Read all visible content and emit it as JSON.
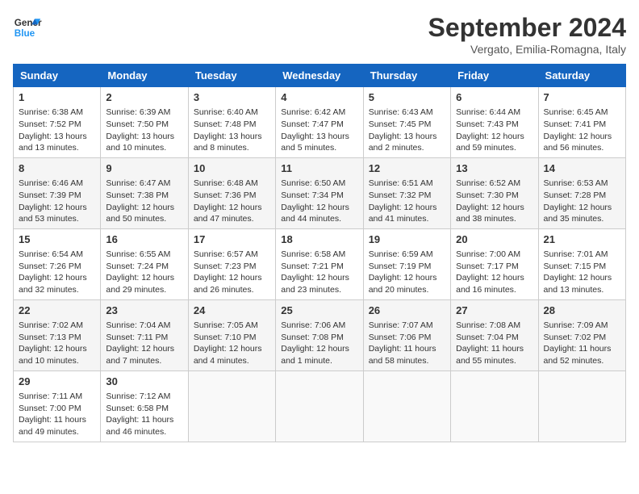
{
  "logo": {
    "line1": "General",
    "line2": "Blue"
  },
  "title": "September 2024",
  "subtitle": "Vergato, Emilia-Romagna, Italy",
  "days_of_week": [
    "Sunday",
    "Monday",
    "Tuesday",
    "Wednesday",
    "Thursday",
    "Friday",
    "Saturday"
  ],
  "weeks": [
    [
      {
        "day": "1",
        "lines": [
          "Sunrise: 6:38 AM",
          "Sunset: 7:52 PM",
          "Daylight: 13 hours",
          "and 13 minutes."
        ]
      },
      {
        "day": "2",
        "lines": [
          "Sunrise: 6:39 AM",
          "Sunset: 7:50 PM",
          "Daylight: 13 hours",
          "and 10 minutes."
        ]
      },
      {
        "day": "3",
        "lines": [
          "Sunrise: 6:40 AM",
          "Sunset: 7:48 PM",
          "Daylight: 13 hours",
          "and 8 minutes."
        ]
      },
      {
        "day": "4",
        "lines": [
          "Sunrise: 6:42 AM",
          "Sunset: 7:47 PM",
          "Daylight: 13 hours",
          "and 5 minutes."
        ]
      },
      {
        "day": "5",
        "lines": [
          "Sunrise: 6:43 AM",
          "Sunset: 7:45 PM",
          "Daylight: 13 hours",
          "and 2 minutes."
        ]
      },
      {
        "day": "6",
        "lines": [
          "Sunrise: 6:44 AM",
          "Sunset: 7:43 PM",
          "Daylight: 12 hours",
          "and 59 minutes."
        ]
      },
      {
        "day": "7",
        "lines": [
          "Sunrise: 6:45 AM",
          "Sunset: 7:41 PM",
          "Daylight: 12 hours",
          "and 56 minutes."
        ]
      }
    ],
    [
      {
        "day": "8",
        "lines": [
          "Sunrise: 6:46 AM",
          "Sunset: 7:39 PM",
          "Daylight: 12 hours",
          "and 53 minutes."
        ]
      },
      {
        "day": "9",
        "lines": [
          "Sunrise: 6:47 AM",
          "Sunset: 7:38 PM",
          "Daylight: 12 hours",
          "and 50 minutes."
        ]
      },
      {
        "day": "10",
        "lines": [
          "Sunrise: 6:48 AM",
          "Sunset: 7:36 PM",
          "Daylight: 12 hours",
          "and 47 minutes."
        ]
      },
      {
        "day": "11",
        "lines": [
          "Sunrise: 6:50 AM",
          "Sunset: 7:34 PM",
          "Daylight: 12 hours",
          "and 44 minutes."
        ]
      },
      {
        "day": "12",
        "lines": [
          "Sunrise: 6:51 AM",
          "Sunset: 7:32 PM",
          "Daylight: 12 hours",
          "and 41 minutes."
        ]
      },
      {
        "day": "13",
        "lines": [
          "Sunrise: 6:52 AM",
          "Sunset: 7:30 PM",
          "Daylight: 12 hours",
          "and 38 minutes."
        ]
      },
      {
        "day": "14",
        "lines": [
          "Sunrise: 6:53 AM",
          "Sunset: 7:28 PM",
          "Daylight: 12 hours",
          "and 35 minutes."
        ]
      }
    ],
    [
      {
        "day": "15",
        "lines": [
          "Sunrise: 6:54 AM",
          "Sunset: 7:26 PM",
          "Daylight: 12 hours",
          "and 32 minutes."
        ]
      },
      {
        "day": "16",
        "lines": [
          "Sunrise: 6:55 AM",
          "Sunset: 7:24 PM",
          "Daylight: 12 hours",
          "and 29 minutes."
        ]
      },
      {
        "day": "17",
        "lines": [
          "Sunrise: 6:57 AM",
          "Sunset: 7:23 PM",
          "Daylight: 12 hours",
          "and 26 minutes."
        ]
      },
      {
        "day": "18",
        "lines": [
          "Sunrise: 6:58 AM",
          "Sunset: 7:21 PM",
          "Daylight: 12 hours",
          "and 23 minutes."
        ]
      },
      {
        "day": "19",
        "lines": [
          "Sunrise: 6:59 AM",
          "Sunset: 7:19 PM",
          "Daylight: 12 hours",
          "and 20 minutes."
        ]
      },
      {
        "day": "20",
        "lines": [
          "Sunrise: 7:00 AM",
          "Sunset: 7:17 PM",
          "Daylight: 12 hours",
          "and 16 minutes."
        ]
      },
      {
        "day": "21",
        "lines": [
          "Sunrise: 7:01 AM",
          "Sunset: 7:15 PM",
          "Daylight: 12 hours",
          "and 13 minutes."
        ]
      }
    ],
    [
      {
        "day": "22",
        "lines": [
          "Sunrise: 7:02 AM",
          "Sunset: 7:13 PM",
          "Daylight: 12 hours",
          "and 10 minutes."
        ]
      },
      {
        "day": "23",
        "lines": [
          "Sunrise: 7:04 AM",
          "Sunset: 7:11 PM",
          "Daylight: 12 hours",
          "and 7 minutes."
        ]
      },
      {
        "day": "24",
        "lines": [
          "Sunrise: 7:05 AM",
          "Sunset: 7:10 PM",
          "Daylight: 12 hours",
          "and 4 minutes."
        ]
      },
      {
        "day": "25",
        "lines": [
          "Sunrise: 7:06 AM",
          "Sunset: 7:08 PM",
          "Daylight: 12 hours",
          "and 1 minute."
        ]
      },
      {
        "day": "26",
        "lines": [
          "Sunrise: 7:07 AM",
          "Sunset: 7:06 PM",
          "Daylight: 11 hours",
          "and 58 minutes."
        ]
      },
      {
        "day": "27",
        "lines": [
          "Sunrise: 7:08 AM",
          "Sunset: 7:04 PM",
          "Daylight: 11 hours",
          "and 55 minutes."
        ]
      },
      {
        "day": "28",
        "lines": [
          "Sunrise: 7:09 AM",
          "Sunset: 7:02 PM",
          "Daylight: 11 hours",
          "and 52 minutes."
        ]
      }
    ],
    [
      {
        "day": "29",
        "lines": [
          "Sunrise: 7:11 AM",
          "Sunset: 7:00 PM",
          "Daylight: 11 hours",
          "and 49 minutes."
        ]
      },
      {
        "day": "30",
        "lines": [
          "Sunrise: 7:12 AM",
          "Sunset: 6:58 PM",
          "Daylight: 11 hours",
          "and 46 minutes."
        ]
      },
      {
        "day": "",
        "lines": []
      },
      {
        "day": "",
        "lines": []
      },
      {
        "day": "",
        "lines": []
      },
      {
        "day": "",
        "lines": []
      },
      {
        "day": "",
        "lines": []
      }
    ]
  ]
}
